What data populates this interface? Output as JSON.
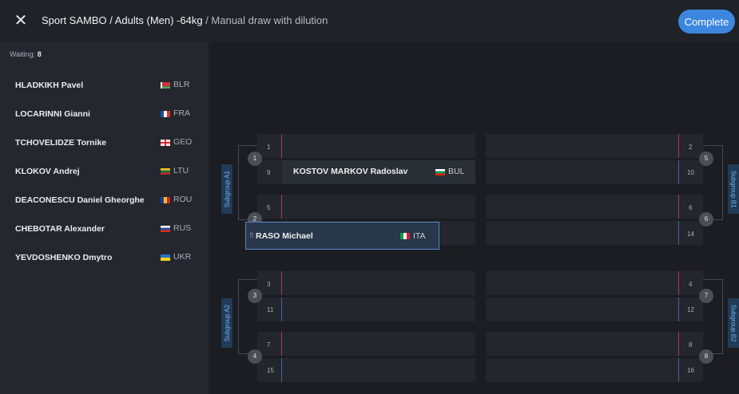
{
  "header": {
    "close_icon": "close-icon",
    "title_main": "Sport SAMBO / Adults (Men) -64kg",
    "title_sub": " / Manual draw with dilution",
    "complete_label": "Complete",
    "accent": "#3c86e0"
  },
  "sidebar": {
    "waiting_label": "Waiting:",
    "waiting_count": "8",
    "athletes": [
      {
        "name": "HLADKIKH Pavel",
        "country": "BLR",
        "flag": "flag-blr"
      },
      {
        "name": "LOCARINNI Gianni",
        "country": "FRA",
        "flag": "flag-fra"
      },
      {
        "name": "TCHOVELIDZE Tornike",
        "country": "GEO",
        "flag": "flag-geo"
      },
      {
        "name": "KLOKOV Andrej",
        "country": "LTU",
        "flag": "flag-ltu"
      },
      {
        "name": "DEACONESCU Daniel Gheorghe",
        "country": "ROU",
        "flag": "flag-rou"
      },
      {
        "name": "CHEBOTAR Alexander",
        "country": "RUS",
        "flag": "flag-rus"
      },
      {
        "name": "YEVDOSHENKO Dmytro",
        "country": "UKR",
        "flag": "flag-ukr"
      }
    ]
  },
  "bracket": {
    "subgroups": {
      "a1": "Subgroup A1",
      "a2": "Subgroup A2",
      "b1": "Subgroup B1",
      "b2": "Subgroup B2"
    },
    "slot_numbers": {
      "s1": "1",
      "s9": "9",
      "s5": "5",
      "s2": "2",
      "s3": "3",
      "s11": "11",
      "s7": "7",
      "s15": "15",
      "s2r": "2",
      "s10": "10",
      "s6": "6",
      "s14": "14",
      "s4": "4",
      "s12": "12",
      "s8": "8",
      "s16": "16"
    },
    "circles": {
      "l1": "1",
      "l2": "2",
      "l3": "3",
      "l4": "4",
      "r5": "5",
      "r6": "6",
      "r7": "7",
      "r8": "8"
    },
    "placed": {
      "name": "KOSTOV MARKOV Radoslav",
      "country": "BUL"
    },
    "dragging": {
      "name": "RASO Michael",
      "country": "ITA",
      "handle": "⠿"
    }
  }
}
